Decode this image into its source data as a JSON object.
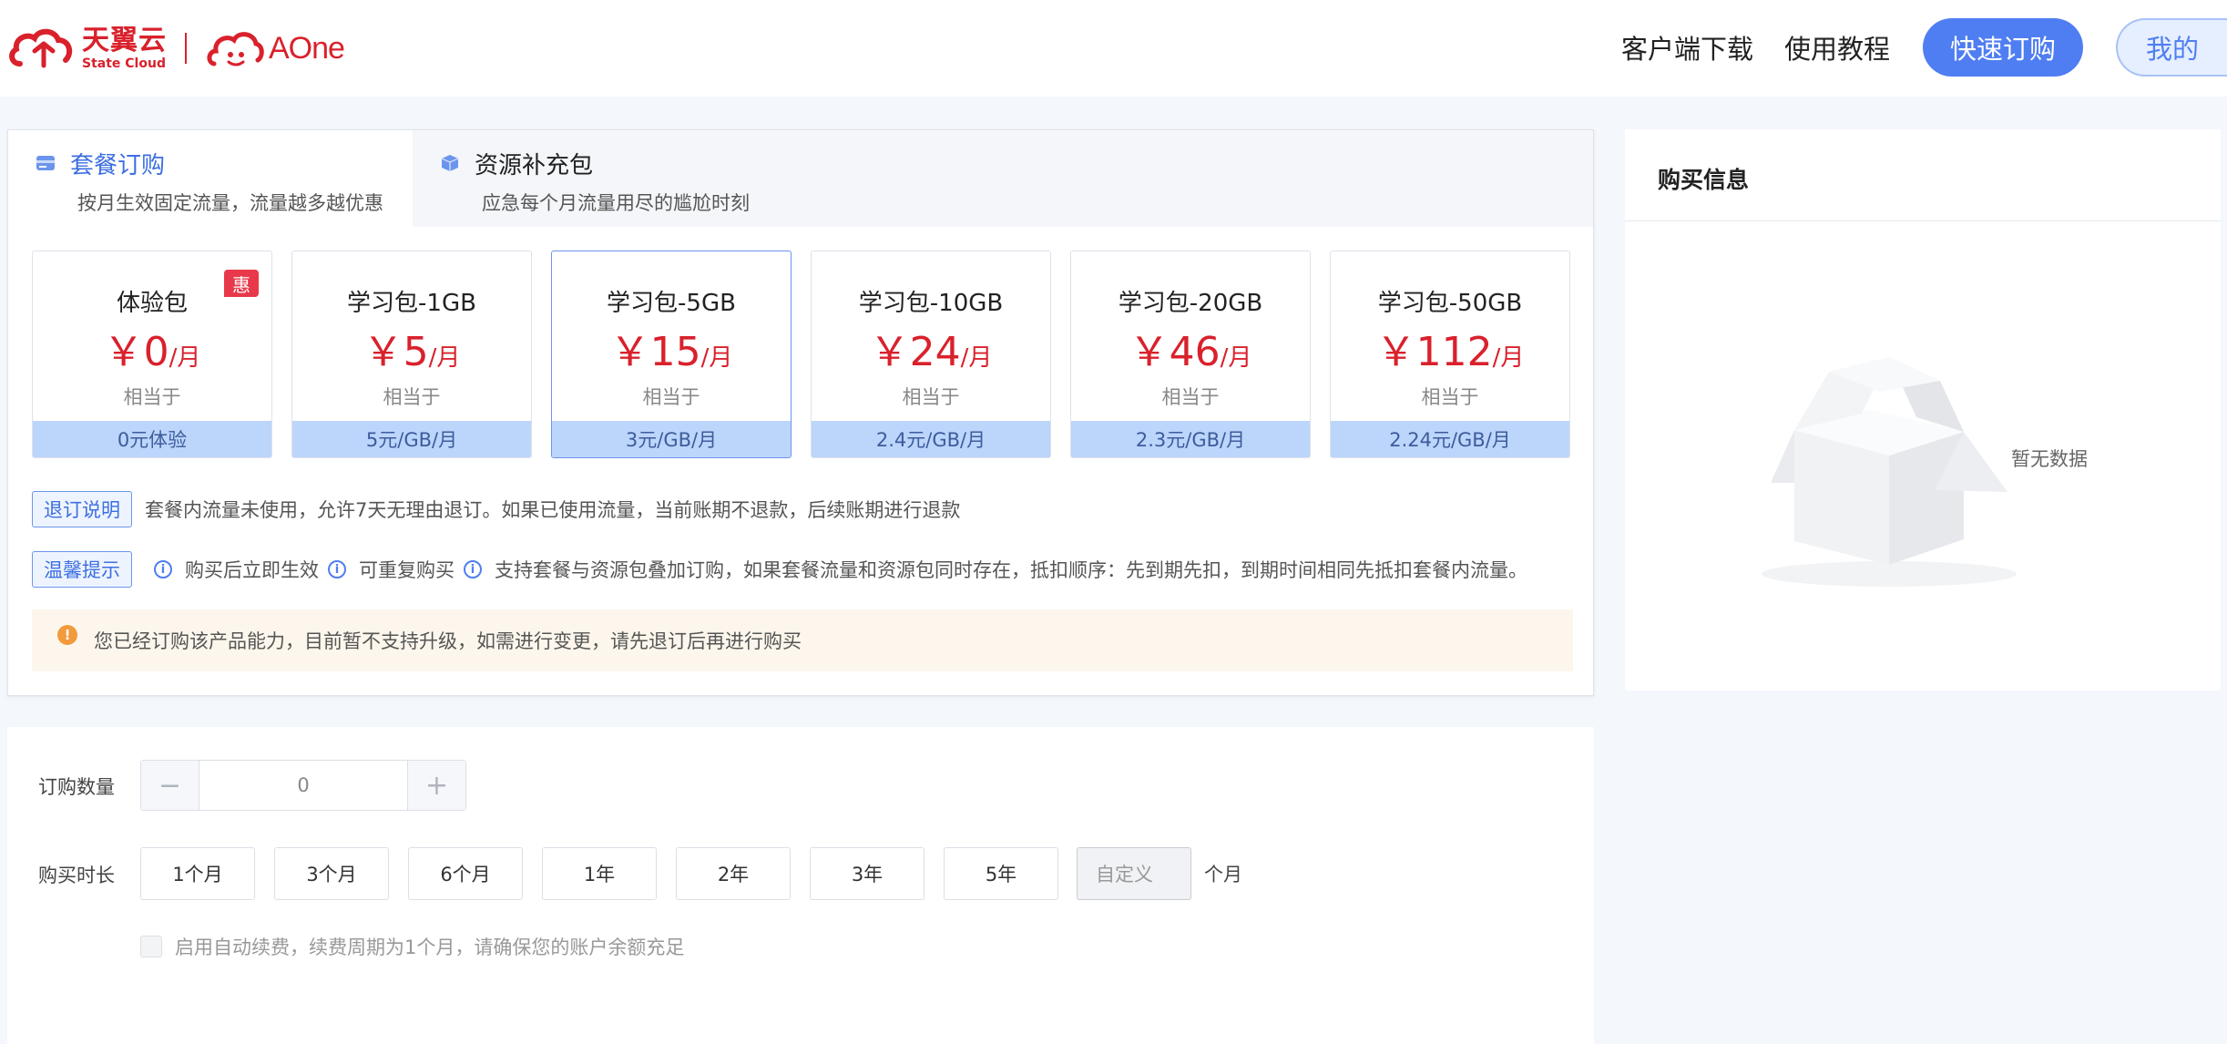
{
  "header": {
    "logo_cn": "天翼云",
    "logo_en": "State Cloud",
    "logo_aone": "AOne",
    "nav": {
      "client_download": "客户端下载",
      "tutorial": "使用教程",
      "quick_order": "快速订购",
      "mine": "我的"
    }
  },
  "tabs": [
    {
      "title": "套餐订购",
      "subtitle": "按月生效固定流量，流量越多越优惠",
      "active": true
    },
    {
      "title": "资源补充包",
      "subtitle": "应急每个月流量用尽的尴尬时刻",
      "active": false
    }
  ],
  "plans": [
    {
      "name": "体验包",
      "currency": "￥",
      "price": "0",
      "unit": "/月",
      "equiv": "相当于",
      "unit_price": "0元体验",
      "badge": "惠",
      "selected": false
    },
    {
      "name": "学习包-1GB",
      "currency": "￥",
      "price": "5",
      "unit": "/月",
      "equiv": "相当于",
      "unit_price": "5元/GB/月",
      "selected": false
    },
    {
      "name": "学习包-5GB",
      "currency": "￥",
      "price": "15",
      "unit": "/月",
      "equiv": "相当于",
      "unit_price": "3元/GB/月",
      "selected": true
    },
    {
      "name": "学习包-10GB",
      "currency": "￥",
      "price": "24",
      "unit": "/月",
      "equiv": "相当于",
      "unit_price": "2.4元/GB/月",
      "selected": false
    },
    {
      "name": "学习包-20GB",
      "currency": "￥",
      "price": "46",
      "unit": "/月",
      "equiv": "相当于",
      "unit_price": "2.3元/GB/月",
      "selected": false
    },
    {
      "name": "学习包-50GB",
      "currency": "￥",
      "price": "112",
      "unit": "/月",
      "equiv": "相当于",
      "unit_price": "2.24元/GB/月",
      "selected": false
    }
  ],
  "refund": {
    "tag": "退订说明",
    "text": "套餐内流量未使用，允许7天无理由退订。如果已使用流量，当前账期不退款，后续账期进行退款"
  },
  "tips": {
    "tag": "温馨提示",
    "items": [
      "购买后立即生效",
      "可重复购买",
      "支持套餐与资源包叠加订购，如果套餐流量和资源包同时存在，抵扣顺序：先到期先扣，到期时间相同先抵扣套餐内流量。"
    ]
  },
  "alert": {
    "text": "您已经订购该产品能力，目前暂不支持升级，如需进行变更，请先退订后再进行购买"
  },
  "order": {
    "quantity_label": "订购数量",
    "quantity_value": "0",
    "minus": "−",
    "plus": "+",
    "duration_label": "购买时长",
    "durations": [
      "1个月",
      "3个月",
      "6个月",
      "1年",
      "2年",
      "3年",
      "5年"
    ],
    "custom_placeholder": "自定义",
    "custom_unit": "个月",
    "auto_renew": "启用自动续费，续费周期为1个月，请确保您的账户余额充足"
  },
  "purchase_info": {
    "title": "购买信息",
    "empty": "暂无数据"
  },
  "colors": {
    "brand_red": "#d9212c",
    "primary_blue": "#4f7ef2",
    "plan_footer": "#bcd5fb",
    "alert_bg": "#fdf6ec",
    "alert_icon": "#f29a3d"
  }
}
